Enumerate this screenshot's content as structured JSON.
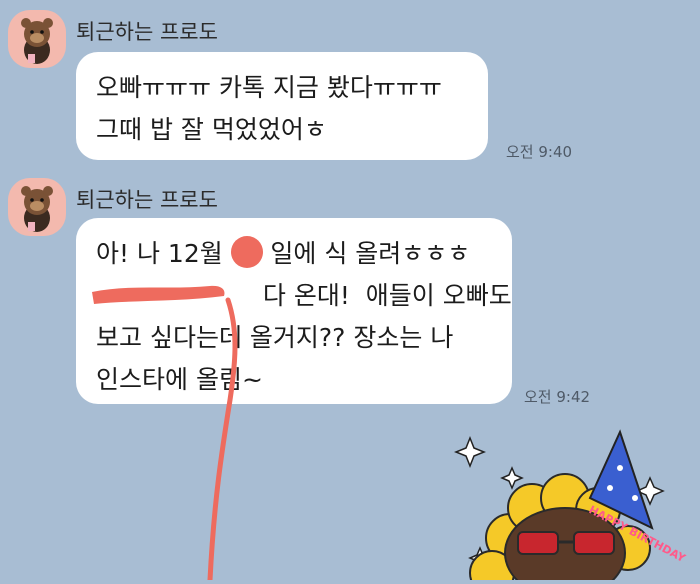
{
  "messages": [
    {
      "sender": "퇴근하는 프로도",
      "lines": [
        "오빠ㅠㅠㅠ 카톡 지금 봤다ㅠㅠㅠ",
        "그때 밥 잘 먹었었어ㅎ"
      ],
      "time": "오전 9:40"
    },
    {
      "sender": "퇴근하는 프로도",
      "lines": [
        "아! 나 12월      일에 식 올려ㅎㅎㅎ",
        "                     다 온대!  애들이 오빠도",
        "보고 싶다는데 올거지?? 장소는 나",
        "인스타에 올림~"
      ],
      "time": "오전 9:42"
    }
  ],
  "sticker": {
    "hat_text": "HAPPY BIRTHDAY",
    "icon": "birthday-sticker-icon"
  },
  "colors": {
    "background": "#a8bdd3",
    "bubble": "#ffffff",
    "avatar": "#f3b9ae",
    "redaction": "#ee6b5e"
  }
}
